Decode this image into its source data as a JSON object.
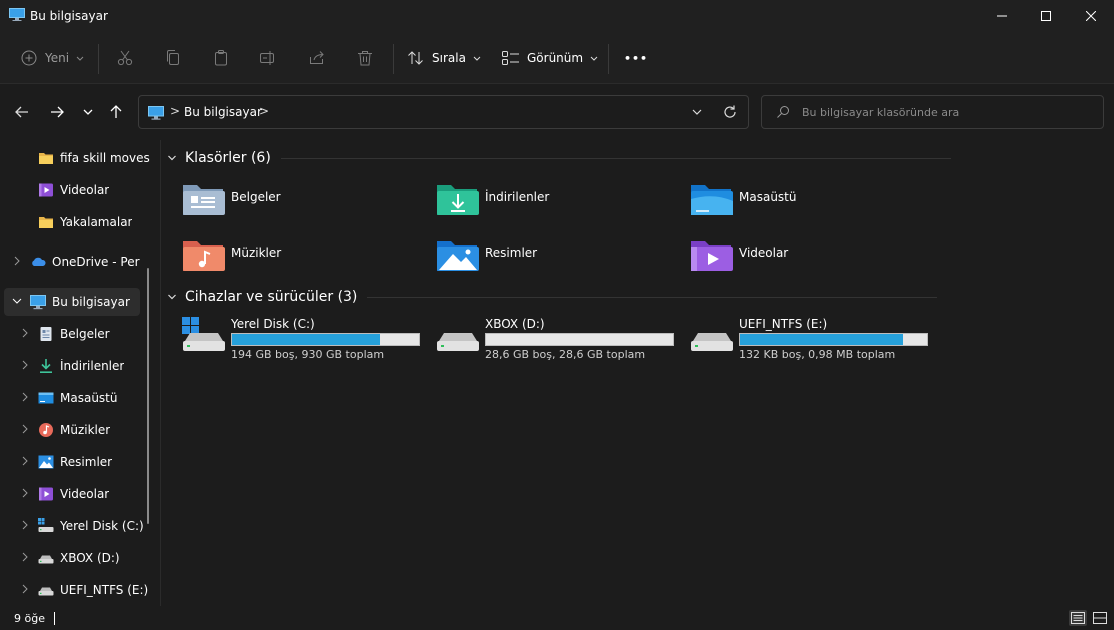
{
  "window": {
    "title": "Bu bilgisayar"
  },
  "toolbar": {
    "new_label": "Yeni",
    "sort_label": "Sırala",
    "view_label": "Görünüm",
    "more_label": "•••"
  },
  "address": {
    "crumb": "Bu bilgisayar",
    "separator": ">"
  },
  "search": {
    "placeholder": "Bu bilgisayar klasöründe ara"
  },
  "sidebar": {
    "items": [
      {
        "label": "fifa skill moves",
        "icon": "folder-icon"
      },
      {
        "label": "Videolar",
        "icon": "videos-icon"
      },
      {
        "label": "Yakalamalar",
        "icon": "folder-icon"
      },
      {
        "label": "OneDrive - Perso",
        "icon": "onedrive-icon"
      },
      {
        "label": "Bu bilgisayar",
        "icon": "pc-icon"
      },
      {
        "label": "Belgeler",
        "icon": "documents-icon"
      },
      {
        "label": "İndirilenler",
        "icon": "downloads-icon"
      },
      {
        "label": "Masaüstü",
        "icon": "desktop-icon"
      },
      {
        "label": "Müzikler",
        "icon": "music-icon"
      },
      {
        "label": "Resimler",
        "icon": "pictures-icon"
      },
      {
        "label": "Videolar",
        "icon": "videos-icon"
      },
      {
        "label": "Yerel Disk (C:)",
        "icon": "system-drive-icon"
      },
      {
        "label": "XBOX (D:)",
        "icon": "drive-icon"
      },
      {
        "label": "UEFI_NTFS (E:)",
        "icon": "drive-icon"
      }
    ]
  },
  "folders": {
    "header": "Klasörler (6)",
    "items": [
      {
        "label": "Belgeler",
        "icon": "documents-folder-icon"
      },
      {
        "label": "İndirilenler",
        "icon": "downloads-folder-icon"
      },
      {
        "label": "Masaüstü",
        "icon": "desktop-folder-icon"
      },
      {
        "label": "Müzikler",
        "icon": "music-folder-icon"
      },
      {
        "label": "Resimler",
        "icon": "pictures-folder-icon"
      },
      {
        "label": "Videolar",
        "icon": "videos-folder-icon"
      }
    ]
  },
  "drives": {
    "header": "Cihazlar ve sürücüler (3)",
    "items": [
      {
        "label": "Yerel Disk (C:)",
        "info": "194 GB boş, 930 GB toplam",
        "used_fraction": 0.79,
        "icon": "system-drive-icon"
      },
      {
        "label": "XBOX (D:)",
        "info": "28,6 GB boş, 28,6 GB toplam",
        "used_fraction": 0.0,
        "icon": "drive-icon"
      },
      {
        "label": "UEFI_NTFS (E:)",
        "info": "132 KB boş, 0,98 MB toplam",
        "used_fraction": 0.87,
        "icon": "drive-icon"
      }
    ]
  },
  "status": {
    "item_count": "9 öğe"
  },
  "colors": {
    "background": "#1c1c1c",
    "chrome": "#202020",
    "accent": "#26a0da",
    "selection": "#2d2d2d"
  }
}
